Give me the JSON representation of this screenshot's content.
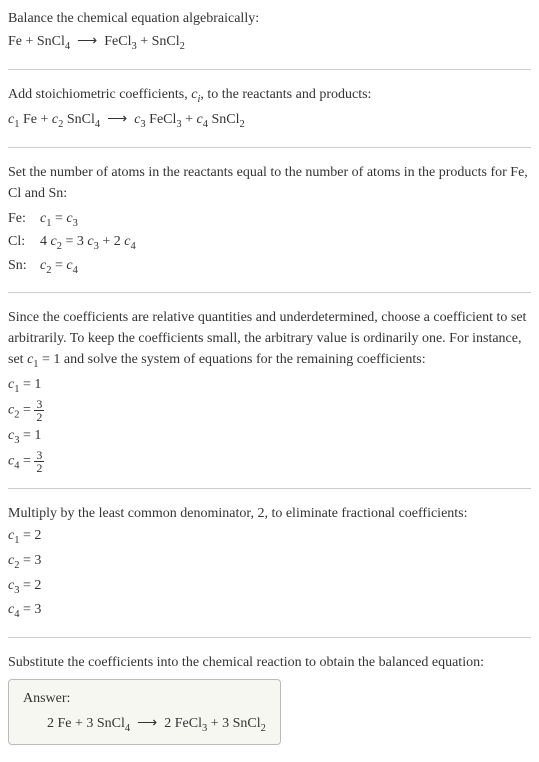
{
  "step1": {
    "text": "Balance the chemical equation algebraically:",
    "eq": "Fe + SnCl₄  ⟶  FeCl₃ + SnCl₂"
  },
  "step2": {
    "text_before": "Add stoichiometric coefficients, ",
    "ci": "cᵢ",
    "text_after": ", to the reactants and products:",
    "eq_parts": {
      "c1": "c₁",
      "fe": " Fe + ",
      "c2": "c₂",
      "sncl4": " SnCl₄  ⟶  ",
      "c3": "c₃",
      "fecl3": " FeCl₃ + ",
      "c4": "c₄",
      "sncl2": " SnCl₂"
    },
    "eq": "c₁ Fe + c₂ SnCl₄  ⟶  c₃ FeCl₃ + c₄ SnCl₂"
  },
  "step3": {
    "text": "Set the number of atoms in the reactants equal to the number of atoms in the products for Fe, Cl and Sn:",
    "rows": [
      {
        "el": "Fe:",
        "eq": "c₁ = c₃"
      },
      {
        "el": "Cl:",
        "eq": "4 c₂ = 3 c₃ + 2 c₄"
      },
      {
        "el": "Sn:",
        "eq": "c₂ = c₄"
      }
    ]
  },
  "step4": {
    "text": "Since the coefficients are relative quantities and underdetermined, choose a coefficient to set arbitrarily. To keep the coefficients small, the arbitrary value is ordinarily one. For instance, set c₁ = 1 and solve the system of equations for the remaining coefficients:",
    "c1": "c₁ = 1",
    "c2_lhs": "c₂ = ",
    "c3": "c₃ = 1",
    "c4_lhs": "c₄ = ",
    "frac_top": "3",
    "frac_bot": "2"
  },
  "step5": {
    "text": "Multiply by the least common denominator, 2, to eliminate fractional coefficients:",
    "lines": [
      "c₁ = 2",
      "c₂ = 3",
      "c₃ = 2",
      "c₄ = 3"
    ]
  },
  "step6": {
    "text": "Substitute the coefficients into the chemical reaction to obtain the balanced equation:"
  },
  "answer": {
    "title": "Answer:",
    "eq": "2 Fe + 3 SnCl₄  ⟶  2 FeCl₃ + 3 SnCl₂"
  }
}
